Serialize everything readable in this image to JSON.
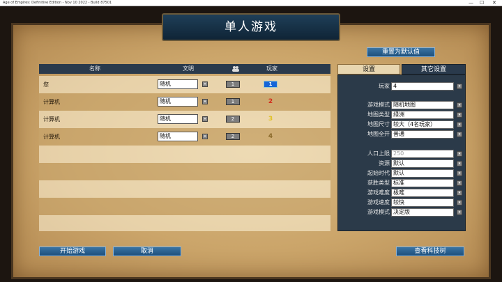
{
  "window": {
    "title": "Age of Empires: Definitive Edition - Nov 10 2022 - Build 87501",
    "minimize": "—",
    "maximize": "☐",
    "close": "✕"
  },
  "screen": {
    "title": "单人游戏"
  },
  "buttons": {
    "reset_defaults": "重置为默认值",
    "start_game": "开始游戏",
    "cancel": "取消",
    "view_tech_tree": "查看科技树"
  },
  "player_table": {
    "headers": {
      "name": "名称",
      "civ": "文明",
      "team_icon": "team-icon",
      "player": "玩家"
    },
    "rows": [
      {
        "name": "您",
        "civ": "随机",
        "team": "1",
        "player": "1",
        "player_color": "#1565d8"
      },
      {
        "name": "计算机",
        "civ": "随机",
        "team": "1",
        "player": "2",
        "player_color": "#d42a1a"
      },
      {
        "name": "计算机",
        "civ": "随机",
        "team": "2",
        "player": "3",
        "player_color": "#e0c020"
      },
      {
        "name": "计算机",
        "civ": "随机",
        "team": "2",
        "player": "4",
        "player_color": "#8a6a2a"
      }
    ]
  },
  "settings": {
    "tabs": {
      "settings": "设置",
      "other": "其它设置"
    },
    "players": {
      "label": "玩家",
      "value": "4"
    },
    "game_mode": {
      "label": "游戏模式",
      "value": "随机地图"
    },
    "map_type": {
      "label": "地图类型",
      "value": "绿洲"
    },
    "map_size": {
      "label": "地图尺寸",
      "value": "较大（4名玩家）"
    },
    "reveal_map": {
      "label": "地图全开",
      "value": "普通"
    },
    "pop_limit": {
      "label": "人口上限",
      "value": "250"
    },
    "resources": {
      "label": "资源",
      "value": "默认"
    },
    "starting_age": {
      "label": "起始时代",
      "value": "默认"
    },
    "victory": {
      "label": "获胜类型",
      "value": "标准"
    },
    "difficulty": {
      "label": "游戏难度",
      "value": "极难"
    },
    "game_speed": {
      "label": "游戏速度",
      "value": "较快"
    },
    "game_mode2": {
      "label": "游戏模式",
      "value": "决定版"
    }
  },
  "colors": {
    "accent_blue": "#1d4f7c",
    "panel": "#2b3a49"
  }
}
